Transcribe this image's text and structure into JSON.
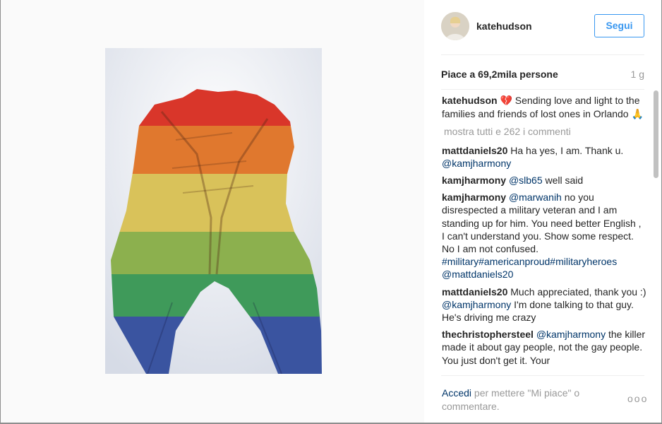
{
  "post": {
    "username": "katehudson",
    "follow_label": "Segui",
    "likes": "Piace a 69,2mila persone",
    "time_ago": "1 g"
  },
  "caption": {
    "author": "katehudson",
    "emoji_start": "💔",
    "text": " Sending love and light to the families and friends of lost ones in Orlando ",
    "emoji_end": "🙏"
  },
  "show_all": "mostra tutti e 262 i commenti",
  "comments": [
    {
      "author": "mattdaniels20",
      "parts": [
        {
          "t": " Ha ha yes, I am. Thank u. "
        },
        {
          "m": "@kamjharmony"
        }
      ]
    },
    {
      "author": "kamjharmony",
      "parts": [
        {
          "t": " "
        },
        {
          "m": "@slb65"
        },
        {
          "t": " well said"
        }
      ]
    },
    {
      "author": "kamjharmony",
      "parts": [
        {
          "t": " "
        },
        {
          "m": "@marwanih"
        },
        {
          "t": " no you disrespected a military veteran and I am standing up for him. You need better English , I can't understand you. Show some respect. No I am not confused. "
        },
        {
          "m": "#military"
        },
        {
          "m": "#americanproud"
        },
        {
          "m": "#militaryheroes"
        },
        {
          "t": " "
        },
        {
          "m": "@mattdaniels20"
        }
      ]
    },
    {
      "author": "mattdaniels20",
      "parts": [
        {
          "t": " Much appreciated, thank you :) "
        },
        {
          "m": "@kamjharmony"
        },
        {
          "t": " I'm done talking to that guy. He's driving me crazy"
        }
      ]
    },
    {
      "author": "thechristophersteel",
      "parts": [
        {
          "t": " "
        },
        {
          "m": "@kamjharmony"
        },
        {
          "t": " the killer made it about gay people, not the gay people. You just don't get it. Your"
        }
      ]
    }
  ],
  "footer": {
    "login_label": "Accedi",
    "text": " per mettere \"Mi piace\" o commentare.",
    "more_label": "ooo"
  },
  "icons": {
    "more": "more-options-icon"
  },
  "colors": {
    "accent": "#3897f0",
    "link": "#003569",
    "muted": "#999999"
  }
}
